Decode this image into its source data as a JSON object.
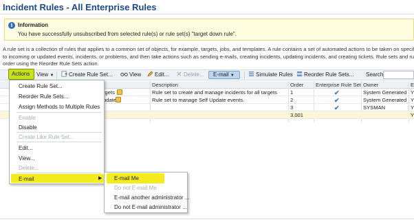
{
  "page": {
    "title": "Incident Rules - All Enterprise Rules"
  },
  "info": {
    "heading": "Information",
    "message": "You have successfully unsubscribed from selected rule(s) or rule set(s) \"target down rule\"."
  },
  "description": {
    "line1": "A rule set is a collection of rules that applies to a common set of objects, for example, targets, jobs, and templates. A rule contains a set of automated actions to be taken on specific e",
    "line2": "to incoming or updated events, incidents, or problems, and then take actions such as sending e-mails, creating incidents, updating incidents, and creating tickets. Rule sets and rules a",
    "line3": "order using the Reorder Rule Sets action."
  },
  "toolbar": {
    "actions_label": "Actions",
    "view_label": "View",
    "create_rule_set_label": "Create Rule Set...",
    "view_button_label": "View",
    "edit_label": "Edit...",
    "delete_label": "Delete...",
    "email_label": "E-mail",
    "simulate_label": "Simulate Rules",
    "reorder_label": "Reorder Rule Sets...",
    "search_label": "Search",
    "search_value": ""
  },
  "table": {
    "columns": [
      "Description",
      "Order",
      "Enterprise Rule Set",
      "Owner",
      "E"
    ],
    "rows": [
      {
        "name_fragment": "rgets",
        "description": "Rule set to create and manage incidents for all targets",
        "order": "1",
        "enterprise": true,
        "owner": "System Generated",
        "extra": "Y"
      },
      {
        "name_fragment": "pdate",
        "description": "Rule set to manage Self Update events.",
        "order": "2",
        "enterprise": true,
        "owner": "System Generated",
        "extra": "Y"
      },
      {
        "name_fragment": "",
        "description": "",
        "order": "3",
        "enterprise": true,
        "owner": "SYSMAN",
        "extra": "Y"
      },
      {
        "name_fragment": "",
        "description": "",
        "order": "3.001",
        "enterprise": false,
        "owner": "",
        "extra": "Y"
      }
    ]
  },
  "actions_menu": {
    "items": [
      {
        "label": "Create Rule Set...",
        "disabled": false
      },
      {
        "label": "Reorder Rule Sets...",
        "disabled": false
      },
      {
        "label": "Assign Methods to Multiple Rules",
        "disabled": false
      },
      {
        "label": "Enable",
        "disabled": true
      },
      {
        "label": "Disable",
        "disabled": false
      },
      {
        "label": "Create Like Rule Set...",
        "disabled": true
      },
      {
        "label": "Edit...",
        "disabled": false
      },
      {
        "label": "View...",
        "disabled": false
      },
      {
        "label": "Delete...",
        "disabled": true
      },
      {
        "label": "E-mail",
        "disabled": false
      }
    ]
  },
  "email_submenu": {
    "items": [
      {
        "label": "E-mail Me",
        "disabled": false
      },
      {
        "label": "Do not E-mail Me",
        "disabled": true
      },
      {
        "label": "E-mail another administrator ...",
        "disabled": false
      },
      {
        "label": "Do not E-mail administrator ...",
        "disabled": false
      }
    ]
  },
  "colors": {
    "title": "#1d4a86",
    "highlight": "#f4ec1e",
    "actions_button": "#c8e11a",
    "email_button": "#bcd6ef",
    "check": "#3b74c8"
  },
  "icons": [
    "info-icon",
    "create-rule-set-icon",
    "view-glasses-icon",
    "edit-pencil-icon",
    "delete-x-icon",
    "simulate-rules-icon",
    "reorder-icon",
    "lock-icon",
    "check-icon",
    "chevron-down-icon",
    "submenu-arrow-icon"
  ]
}
